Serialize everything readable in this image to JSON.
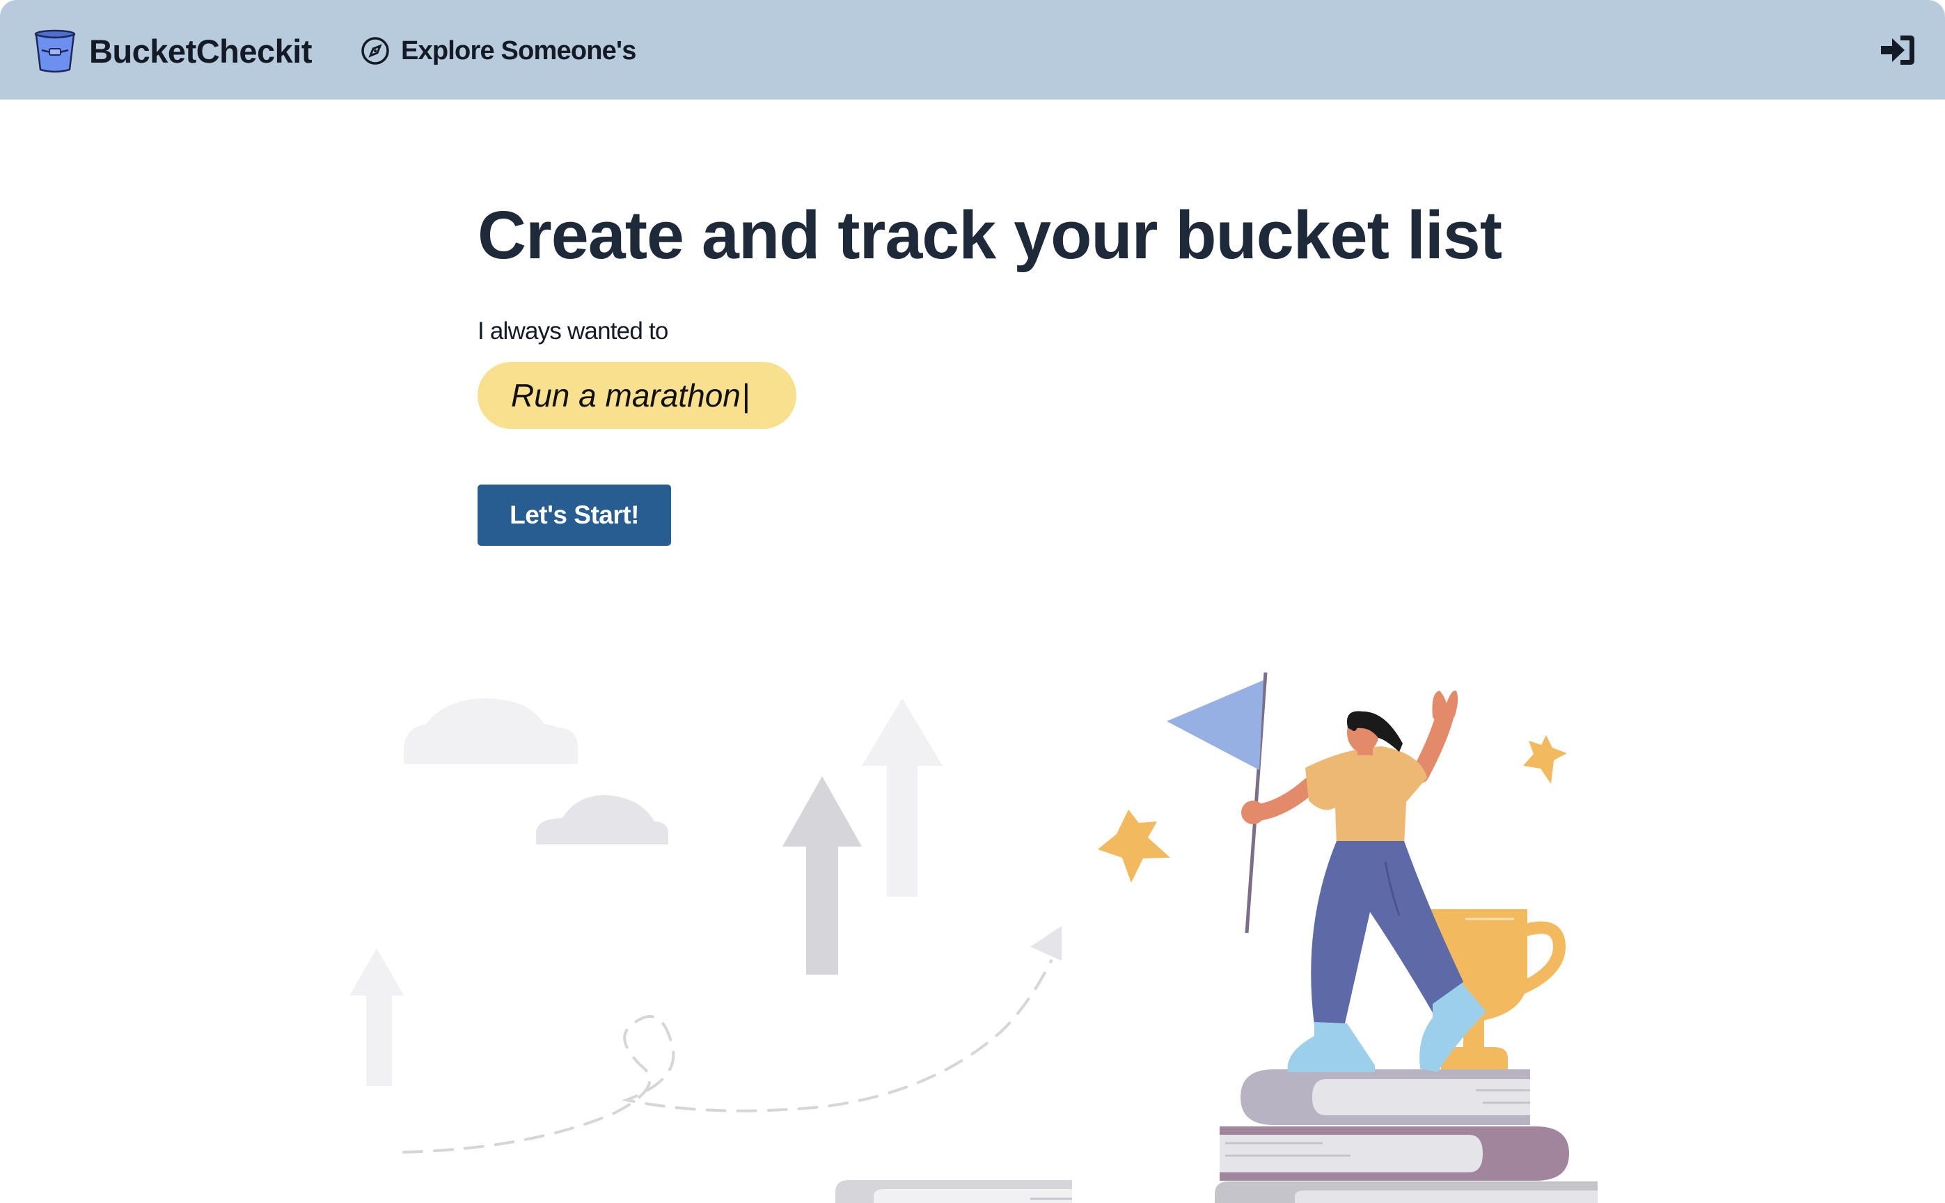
{
  "app": {
    "brand_name": "BucketCheckit",
    "brand_icon": "bucket-icon"
  },
  "nav": {
    "explore_label": "Explore Someone's",
    "explore_icon": "compass-icon",
    "login_icon": "sign-in-icon"
  },
  "hero": {
    "title": "Create and track your bucket list",
    "prompt_label": "I always wanted to",
    "wish_value": "Run a marathon",
    "start_button_label": "Let's Start!"
  },
  "colors": {
    "header_bg": "#b8cbdc",
    "input_bg": "#f8e08e",
    "button_bg": "#285d92",
    "title_text": "#1e2a3a"
  }
}
